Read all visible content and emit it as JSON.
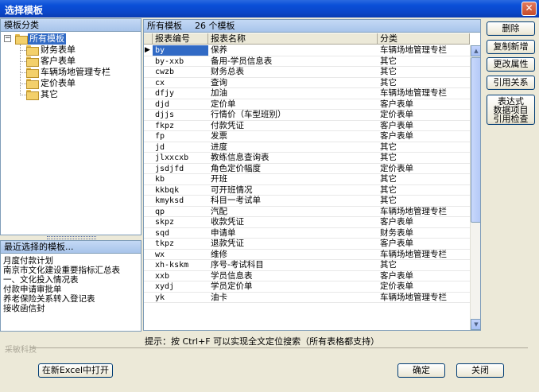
{
  "window": {
    "title": "选择模板",
    "close_icon": "close-icon"
  },
  "category_panel": {
    "header": "模板分类",
    "root": {
      "label": "所有模板",
      "expander": "−"
    },
    "items": [
      "财务表单",
      "客户表单",
      "车辆场地管理专栏",
      "定价表单",
      "其它"
    ]
  },
  "recent_panel": {
    "header": "最近选择的模板...",
    "items": [
      "月度付款计划",
      "南京市文化建设重要指标汇总表",
      "一、文化投入情况表",
      "付款申请审批单",
      "养老保险关系转入登记表",
      "接收函信封"
    ]
  },
  "grid": {
    "title": "所有模板",
    "count_text": "26 个模板",
    "columns": [
      "报表编号",
      "报表名称",
      "分类"
    ],
    "rows": [
      [
        "by",
        "保养",
        "车辆场地管理专栏"
      ],
      [
        "by-xxb",
        "备用-学员信息表",
        "其它"
      ],
      [
        "cwzb",
        "财务总表",
        "其它"
      ],
      [
        "cx",
        "查询",
        "其它"
      ],
      [
        "dfjy",
        "加油",
        "车辆场地管理专栏"
      ],
      [
        "djd",
        "定价单",
        "客户表单"
      ],
      [
        "djjs",
        "行情价（车型班别）",
        "定价表单"
      ],
      [
        "fkpz",
        "付款凭证",
        "客户表单"
      ],
      [
        "fp",
        "发票",
        "客户表单"
      ],
      [
        "jd",
        "进度",
        "其它"
      ],
      [
        "jlxxcxb",
        "教练信息查询表",
        "其它"
      ],
      [
        "jsdjfd",
        "角色定价幅度",
        "定价表单"
      ],
      [
        "kb",
        "开班",
        "其它"
      ],
      [
        "kkbqk",
        "可开班情况",
        "其它"
      ],
      [
        "kmyksd",
        "科目一考试单",
        "其它"
      ],
      [
        "qp",
        "汽配",
        "车辆场地管理专栏"
      ],
      [
        "skpz",
        "收款凭证",
        "客户表单"
      ],
      [
        "sqd",
        "申请单",
        "财务表单"
      ],
      [
        "tkpz",
        "退款凭证",
        "客户表单"
      ],
      [
        "wx",
        "维修",
        "车辆场地管理专栏"
      ],
      [
        "xh-kskm",
        "序号-考试科目",
        "其它"
      ],
      [
        "xxb",
        "学员信息表",
        "客户表单"
      ],
      [
        "xydj",
        "学员定价单",
        "定价表单"
      ],
      [
        "yk",
        "油卡",
        "车辆场地管理专栏"
      ]
    ],
    "selected_row": 0,
    "row_indicator": "▶"
  },
  "side_buttons": {
    "delete": "删除",
    "copy_new": "复制新增",
    "change_props": "更改属性",
    "reference": "引用关系",
    "expr_check_1": "表达式",
    "expr_check_2": "数据项目",
    "expr_check_3": "引用检查"
  },
  "hint": "提示：按 Ctrl+F 可以实现全文定位搜索（所有表格都支持）",
  "group_label": "采敏科技",
  "bottom": {
    "open_excel": "在新Excel中打开",
    "ok": "确定",
    "close": "关闭"
  },
  "scroll": {
    "up": "▲",
    "down": "▼"
  }
}
